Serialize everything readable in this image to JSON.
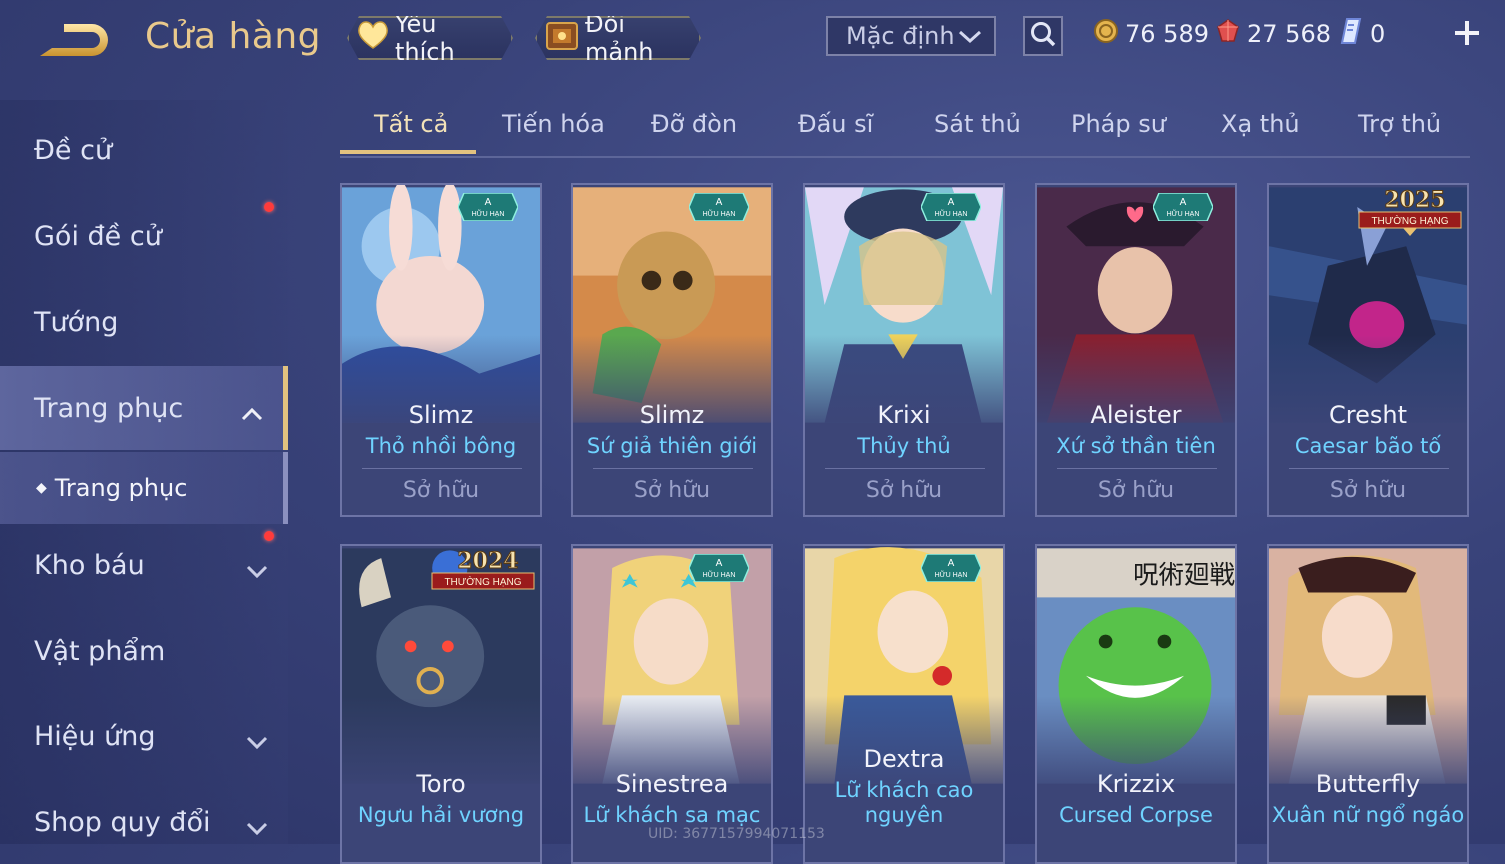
{
  "header": {
    "title": "Cửa hàng",
    "favorites_label": "Yêu thích",
    "exchange_label": "Đổi mảnh",
    "sort_value": "Mặc định",
    "gold": "76 589",
    "gems": "27 568",
    "vouchers": "0"
  },
  "sidebar": {
    "items": [
      {
        "label": "Đề cử"
      },
      {
        "label": "Gói đề cử"
      },
      {
        "label": "Tướng"
      },
      {
        "label": "Trang phục"
      },
      {
        "label": "Kho báu"
      },
      {
        "label": "Vật phẩm"
      },
      {
        "label": "Hiệu ứng"
      },
      {
        "label": "Shop quy đổi"
      }
    ],
    "sub_item": "Trang phục"
  },
  "tabs": [
    "Tất cả",
    "Tiến hóa",
    "Đỡ đòn",
    "Đấu sĩ",
    "Sát thủ",
    "Pháp sư",
    "Xạ thủ",
    "Trợ thủ"
  ],
  "badges": {
    "limited_letter": "A",
    "limited_text": "HỮU HẠN",
    "ranked_text": "THƯỜNG HẠNG",
    "year_2025": "2025",
    "year_2024": "2024"
  },
  "cards": [
    {
      "hero": "Slimz",
      "skin": "Thỏ nhồi bông",
      "status": "Sở hữu"
    },
    {
      "hero": "Slimz",
      "skin": "Sứ giả thiên giới",
      "status": "Sở hữu"
    },
    {
      "hero": "Krixi",
      "skin": "Thủy thủ",
      "status": "Sở hữu"
    },
    {
      "hero": "Aleister",
      "skin": "Xứ sở thần tiên",
      "status": "Sở hữu"
    },
    {
      "hero": "Cresht",
      "skin": "Caesar bão tố",
      "status": "Sở hữu"
    },
    {
      "hero": "Toro",
      "skin": "Ngưu hải vương"
    },
    {
      "hero": "Sinestrea",
      "skin": "Lữ khách sa mạc"
    },
    {
      "hero": "Dextra",
      "skin": "Lữ khách cao",
      "skin2": "nguyên"
    },
    {
      "hero": "Krizzix",
      "skin": "Cursed Corpse"
    },
    {
      "hero": "Butterfly",
      "skin": "Xuân nữ ngổ ngáo"
    }
  ],
  "uid_text": "UID: 3677157994071153",
  "colors": {
    "accent_gold": "#e2c27f",
    "skin_name_blue": "#6fd3ff",
    "notification_red": "#ff3b3b"
  }
}
